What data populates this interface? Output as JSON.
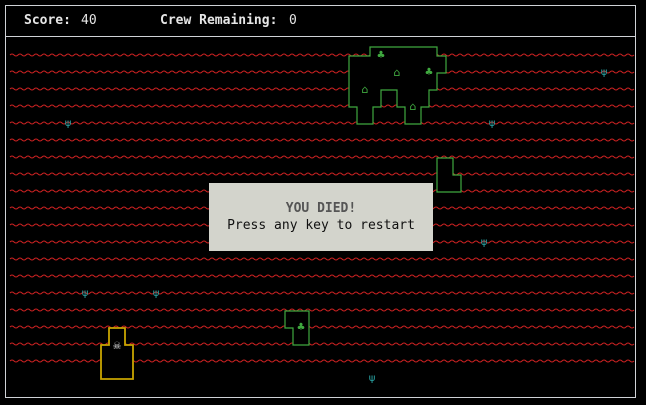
{
  "hud": {
    "score_label": "Score:",
    "score_value": "40",
    "crew_label": "Crew Remaining:",
    "crew_value": "0"
  },
  "message": {
    "title": "YOU DIED!",
    "subtitle": "Press any key to restart"
  },
  "colors": {
    "sea": "#cc2222",
    "land": "#3fa83f",
    "player": "#c8a400",
    "sea_icon": "#2aa7a7",
    "tree": "#3fa83f"
  },
  "icons": {
    "sea_creature": "trident-icon",
    "tree": "tree-icon",
    "hut": "hut-icon",
    "player": "skull-icon"
  },
  "glyphs": {
    "sea_creature": "ψ",
    "tree": "♣",
    "hut": "⌂",
    "player": "☠"
  }
}
